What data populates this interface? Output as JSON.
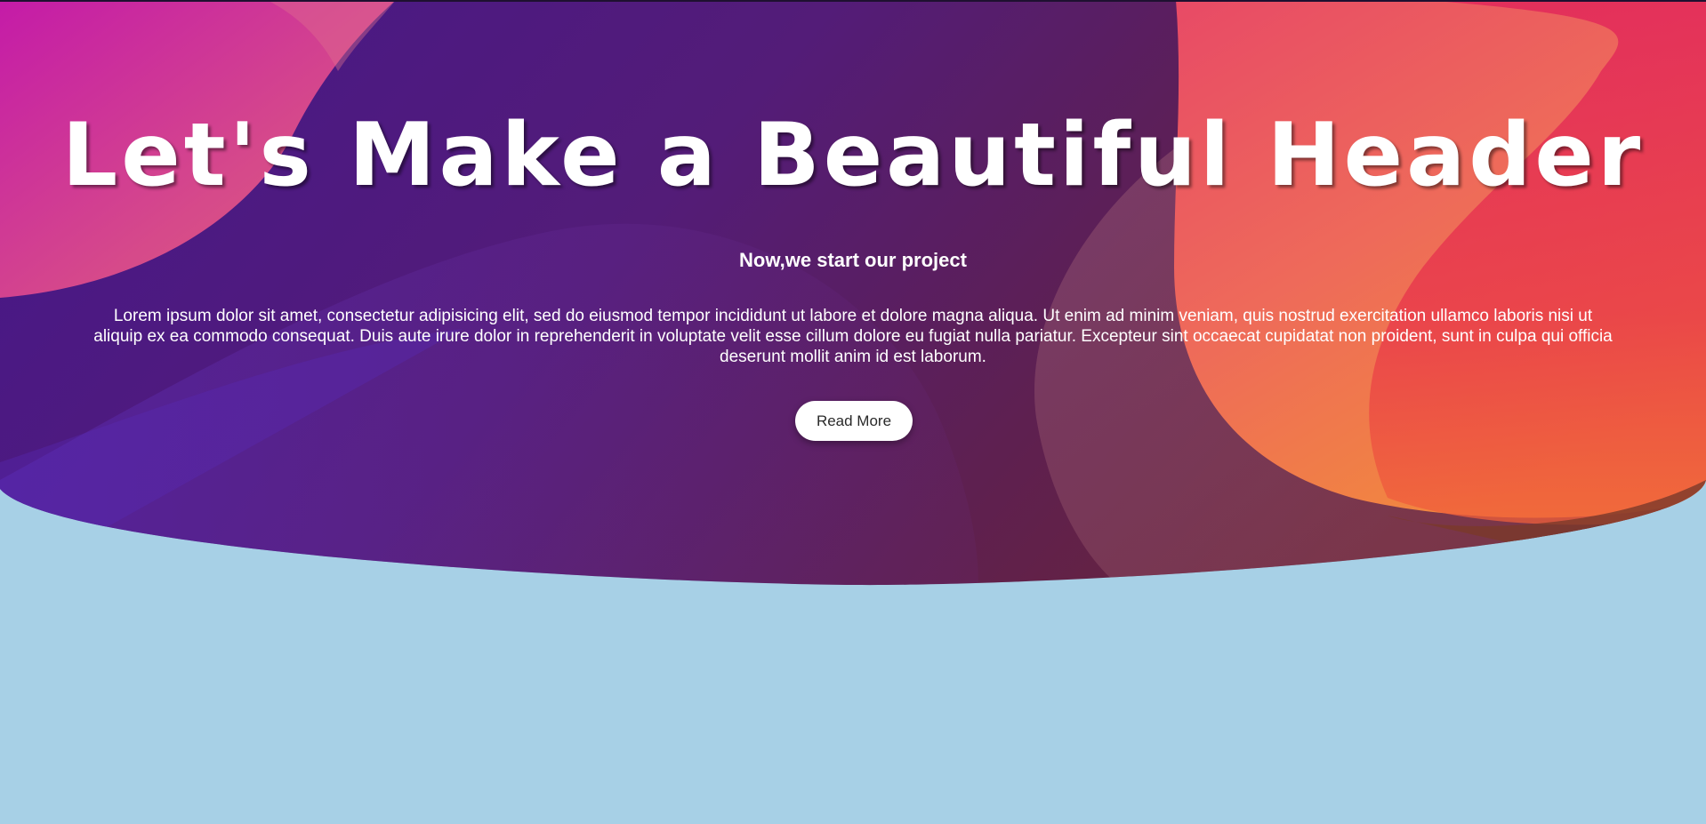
{
  "hero": {
    "title": "Let's Make a Beautiful Header",
    "subtitle": "Now,we start our project",
    "body": "Lorem ipsum dolor sit amet, consectetur adipisicing elit, sed do eiusmod tempor incididunt ut labore et dolore magna aliqua. Ut enim ad minim veniam, quis nostrud exercitation ullamco laboris nisi ut aliquip ex ea commodo consequat. Duis aute irure dolor in reprehenderit in voluptate velit esse cillum dolore eu fugiat nulla pariatur. Excepteur sint occaecat cupidatat non proident, sunt in culpa qui officia deserunt mollit anim id est laborum.",
    "button_label": "Read More"
  },
  "colors": {
    "page_background": "#a7d0e6",
    "hero_purple": "#4a1a8a",
    "hero_magenta": "#c21aa6",
    "hero_orange": "#f07a3a",
    "hero_red": "#e8304a",
    "button_background": "#ffffff",
    "text": "#ffffff"
  }
}
